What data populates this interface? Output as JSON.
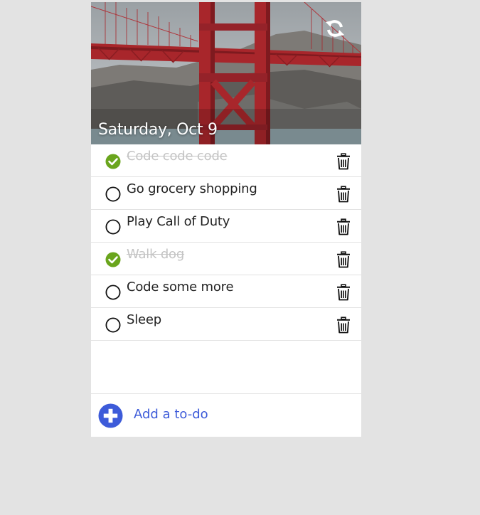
{
  "header": {
    "date": "Saturday, Oct 9",
    "refresh_icon": "refresh-icon",
    "background_image": "golden-gate-bridge"
  },
  "todos": [
    {
      "text": "Code code code",
      "done": true
    },
    {
      "text": "Go grocery shopping",
      "done": false
    },
    {
      "text": "Play Call of Duty",
      "done": false
    },
    {
      "text": "Walk dog",
      "done": true
    },
    {
      "text": "Code some more",
      "done": false
    },
    {
      "text": "Sleep",
      "done": false
    }
  ],
  "footer": {
    "add_label": "Add a to-do",
    "add_icon": "plus-circle-icon"
  },
  "colors": {
    "page_background": "#e3e3e3",
    "card_background": "#ffffff",
    "done_check": "#6aa51d",
    "done_text": "#c4c4c4",
    "accent": "#3d5bd9",
    "bridge": "#a8262b"
  }
}
